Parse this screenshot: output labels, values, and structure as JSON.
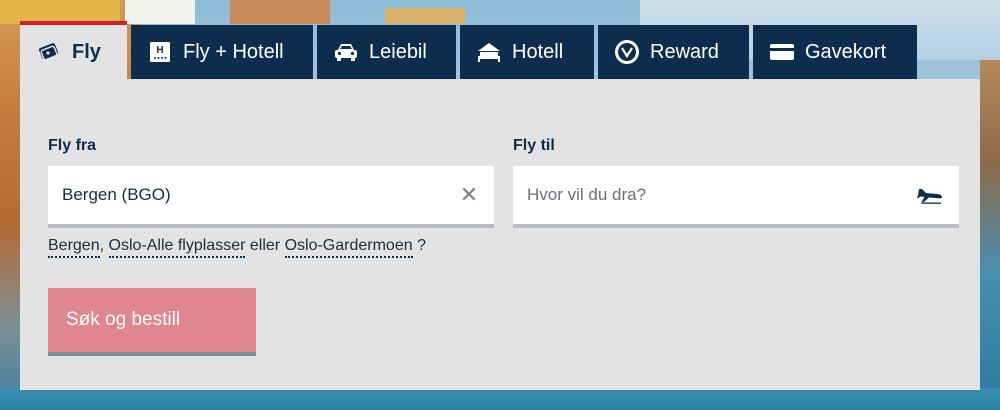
{
  "tabs": [
    {
      "label": "Fly",
      "icon": "ticket-icon",
      "active": true
    },
    {
      "label": "Fly + Hotell",
      "icon": "hotel-h-icon",
      "active": false
    },
    {
      "label": "Leiebil",
      "icon": "car-icon",
      "active": false
    },
    {
      "label": "Hotell",
      "icon": "bed-icon",
      "active": false
    },
    {
      "label": "Reward",
      "icon": "reward-medal-icon",
      "active": false
    },
    {
      "label": "Gavekort",
      "icon": "gift-card-icon",
      "active": false
    }
  ],
  "form": {
    "from_label": "Fly fra",
    "from_value": "Bergen (BGO)",
    "to_label": "Fly til",
    "to_placeholder": "Hvor vil du dra?",
    "suggestions": {
      "items": [
        "Bergen",
        "Oslo-Alle flyplasser",
        "Oslo-Gardermoen"
      ],
      "sep1": ",",
      "sep2": "eller",
      "end": "?"
    },
    "search_button": "Søk og bestill"
  },
  "colors": {
    "tab_bg": "#0d2d4f",
    "active_tab_accent": "#d0202c",
    "button_bg": "#e0868f",
    "panel_bg": "#e3e3e3"
  }
}
